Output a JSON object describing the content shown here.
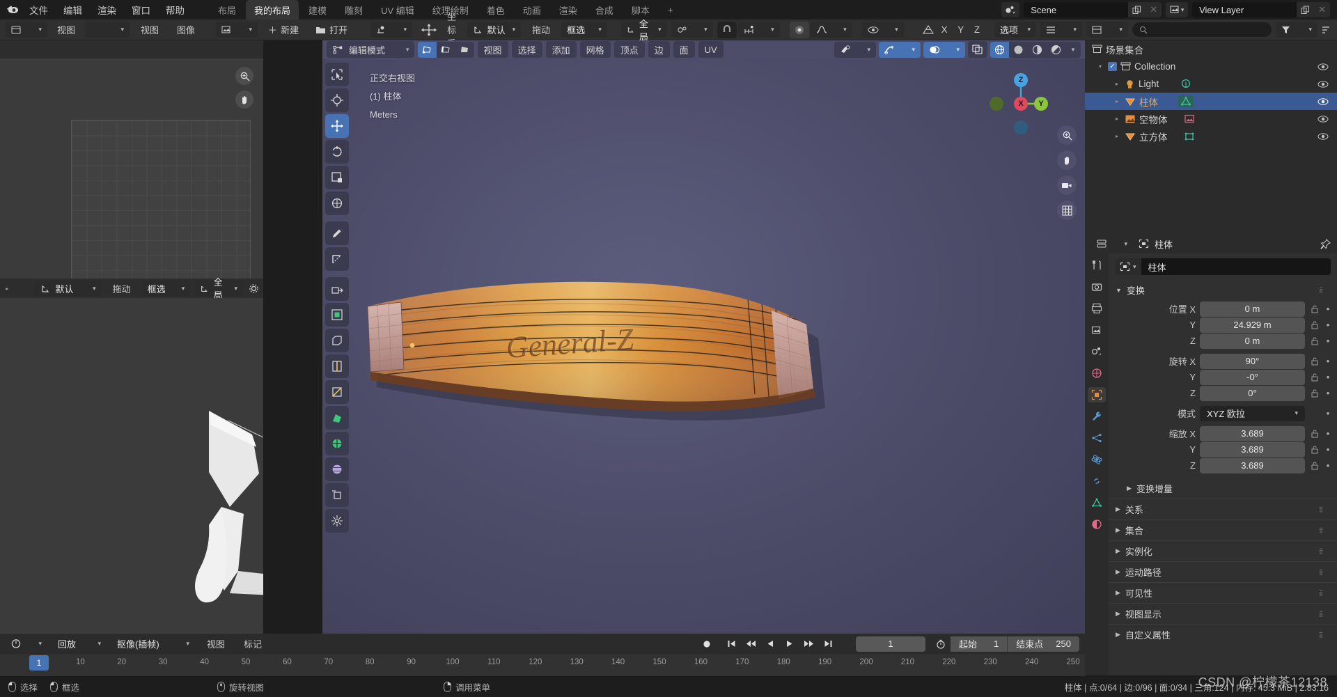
{
  "topbar": {
    "logo_icon": "blender-logo-icon",
    "menus": [
      "文件",
      "编辑",
      "渲染",
      "窗口",
      "帮助"
    ],
    "workspaces": [
      {
        "label": "布局",
        "selected": false
      },
      {
        "label": "我的布局",
        "selected": true
      },
      {
        "label": "建模",
        "selected": false
      },
      {
        "label": "雕刻",
        "selected": false
      },
      {
        "label": "UV 编辑",
        "selected": false
      },
      {
        "label": "纹理绘制",
        "selected": false
      },
      {
        "label": "着色",
        "selected": false
      },
      {
        "label": "动画",
        "selected": false
      },
      {
        "label": "渲染",
        "selected": false
      },
      {
        "label": "合成",
        "selected": false
      },
      {
        "label": "脚本",
        "selected": false
      },
      {
        "label": "+",
        "selected": false
      }
    ],
    "scene": {
      "icon": "scene-icon",
      "value": "Scene",
      "copy_icon": "duplicate-icon",
      "close_icon": "x-icon"
    },
    "viewlayer": {
      "icon": "view-layer-icon",
      "value": "View Layer",
      "copy_icon": "duplicate-icon",
      "close_icon": "x-icon"
    }
  },
  "toolrow": {
    "editor_icon": "editor-type-icon",
    "view_label": "视图",
    "view2_label": "视图",
    "image_label": "图像",
    "new_label": "新建",
    "open_label": "打开",
    "new_icon": "plus-icon",
    "open_icon": "folder-icon",
    "pivot_icon": "pivot-icon",
    "snap_move_icon": "transform-move-icon",
    "orientation_label": "坐标系:",
    "orientation_value": "默认",
    "drag_label": "拖动",
    "drag_value": "框选",
    "global_value": "全局",
    "proportional_icon": "proportional-edit-icon",
    "snap_icon": "magnet-icon",
    "snap_target_icon": "snap-target-icon",
    "falloff_icon": "falloff-icon",
    "visibility_icon": "eye-icon",
    "overlay_icon": "overlay-icon",
    "axis_x": "X",
    "axis_y": "Y",
    "axis_z": "Z",
    "options_label": "选项",
    "search_placeholder": "",
    "filter_icon": "funnel-icon",
    "sort_icon": "sort-icon",
    "search_icon": "search-icon"
  },
  "left_top_editor": {
    "editor_icon": "uv-editor-icon",
    "menus": [
      "视图",
      "视图",
      "图像"
    ],
    "new_label": "新建",
    "open_label": "打开",
    "zoom_icon": "zoom-icon",
    "hand_icon": "hand-icon"
  },
  "left_bottom_editor": {
    "orientation_value": "默认",
    "drag_label": "拖动",
    "drag_value": "框选",
    "global_value": "全局",
    "gear_icon": "gear-icon"
  },
  "viewport": {
    "mode": "编辑模式",
    "mode_icon": "edit-mode-icon",
    "select_modes": [
      {
        "name": "vertex-select",
        "active": true
      },
      {
        "name": "edge-select",
        "active": false
      },
      {
        "name": "face-select",
        "active": false
      }
    ],
    "menus": [
      "视图",
      "选择",
      "添加",
      "网格",
      "顶点",
      "边",
      "面",
      "UV"
    ],
    "overlay_toggles": [
      "visibility-icon",
      "snap-icon",
      "overlays-icon",
      "xray-icon"
    ],
    "shading_modes": [
      "wireframe-shading",
      "solid-shading",
      "material-shading",
      "rendered-shading"
    ],
    "shading_active_index": 0,
    "overlay_text": [
      "正交右视图",
      "(1) 柱体",
      "Meters"
    ],
    "gizmo_axes": [
      {
        "label": "Z",
        "color": "#4aa3e0"
      },
      {
        "label": "X",
        "color": "#e04a5f"
      },
      {
        "label": "Y",
        "color": "#8cc63f"
      }
    ],
    "right_buttons": [
      "zoom-icon",
      "hand-icon",
      "camera-icon",
      "grid-icon"
    ],
    "tools": [
      {
        "name": "tweak-tool",
        "active": false
      },
      {
        "name": "cursor-tool",
        "active": false
      },
      {
        "name": "move-tool",
        "active": true
      },
      {
        "name": "rotate-tool",
        "active": false
      },
      {
        "name": "scale-tool",
        "active": false
      },
      {
        "name": "transform-tool",
        "active": false
      },
      {
        "name": "annotate-tool",
        "active": false
      },
      {
        "name": "measure-tool",
        "active": false
      },
      {
        "name": "extrude-region-tool",
        "active": false
      },
      {
        "name": "inset-faces-tool",
        "active": false
      },
      {
        "name": "bevel-tool",
        "active": false
      },
      {
        "name": "loop-cut-tool",
        "active": false
      },
      {
        "name": "knife-tool",
        "active": false
      },
      {
        "name": "poly-build-tool",
        "active": false
      },
      {
        "name": "spin-tool",
        "active": false
      },
      {
        "name": "smooth-tool",
        "active": false
      },
      {
        "name": "shear-tool",
        "active": false
      },
      {
        "name": "rip-region-tool",
        "active": false
      }
    ],
    "artwork_text": "General-Z"
  },
  "outliner": {
    "editor_icon": "outliner-icon",
    "filter_icon": "filter-icon",
    "search_placeholder": "",
    "search_icon": "search-icon",
    "root_label": "场景集合",
    "root_icon": "collection-icon",
    "items": [
      {
        "label": "Collection",
        "icon": "collection-icon",
        "depth": 1,
        "selected": false,
        "checkbox": true,
        "expanded": true,
        "eye": true
      },
      {
        "label": "Light",
        "icon": "light-icon",
        "type_icon": "light-data-icon",
        "depth": 2,
        "selected": false,
        "eye": true
      },
      {
        "label": "柱体",
        "icon": "mesh-icon",
        "type_icon": "mesh-data-icon",
        "depth": 2,
        "selected": true,
        "eye": true
      },
      {
        "label": "空物体",
        "icon": "empty-image-icon",
        "type_icon": "empty-image-data-icon",
        "depth": 2,
        "selected": false,
        "eye": true
      },
      {
        "label": "立方体",
        "icon": "mesh-icon",
        "type_icon": "mesh-data-icon",
        "depth": 2,
        "selected": false,
        "eye": true
      }
    ]
  },
  "properties": {
    "editor_icon": "properties-icon",
    "breadcrumb_icon": "object-icon",
    "breadcrumb": "柱体",
    "pin_icon": "pin-icon",
    "object_name": "柱体",
    "object_name_icon": "object-icon",
    "tabs": [
      {
        "name": "tool-tab",
        "icon": "wrench-screwdriver-icon",
        "active": false,
        "color": "#c9c9c9"
      },
      {
        "name": "render-tab",
        "icon": "camera-back-icon",
        "active": false,
        "color": "#c9c9c9"
      },
      {
        "name": "output-tab",
        "icon": "printer-icon",
        "active": false,
        "color": "#c9c9c9"
      },
      {
        "name": "view-layer-tab",
        "icon": "images-icon",
        "active": false,
        "color": "#c9c9c9"
      },
      {
        "name": "scene-tab",
        "icon": "cone-sphere-icon",
        "active": false,
        "color": "#c9c9c9"
      },
      {
        "name": "world-tab",
        "icon": "world-icon",
        "active": false,
        "color": "#e06a8a"
      },
      {
        "name": "object-tab",
        "icon": "object-square-icon",
        "active": true,
        "color": "#e58d3d"
      },
      {
        "name": "modifier-tab",
        "icon": "wrench-icon",
        "active": false,
        "color": "#5b9bd5"
      },
      {
        "name": "particles-tab",
        "icon": "particles-icon",
        "active": false,
        "color": "#5b9bd5"
      },
      {
        "name": "physics-tab",
        "icon": "physics-icon",
        "active": false,
        "color": "#5b9bd5"
      },
      {
        "name": "constraints-tab",
        "icon": "constraint-icon",
        "active": false,
        "color": "#5b9bd5"
      },
      {
        "name": "data-tab",
        "icon": "mesh-data-icon",
        "active": false,
        "color": "#3ec1a0"
      },
      {
        "name": "material-tab",
        "icon": "material-sphere-icon",
        "active": false,
        "color": "#e06a8a"
      }
    ],
    "transform_section": {
      "title": "变换",
      "expanded": true,
      "location_label": "位置",
      "location": [
        {
          "axis": "X",
          "value": "0 m"
        },
        {
          "axis": "Y",
          "value": "24.929 m"
        },
        {
          "axis": "Z",
          "value": "0 m"
        }
      ],
      "rotation_label": "旋转",
      "rotation": [
        {
          "axis": "X",
          "value": "90°"
        },
        {
          "axis": "Y",
          "value": "-0°"
        },
        {
          "axis": "Z",
          "value": "0°"
        }
      ],
      "mode_label": "模式",
      "mode_value": "XYZ 欧拉",
      "scale_label": "缩放",
      "scale": [
        {
          "axis": "X",
          "value": "3.689"
        },
        {
          "axis": "Y",
          "value": "3.689"
        },
        {
          "axis": "Z",
          "value": "3.689"
        }
      ]
    },
    "subsection": {
      "label": "变换增量"
    },
    "collapsed_sections": [
      "关系",
      "集合",
      "实例化",
      "运动路径",
      "可见性",
      "视图显示",
      "自定义属性"
    ]
  },
  "timeline": {
    "editor_icon": "timeline-icon",
    "playback_label": "回放",
    "keying_label": "抠像(插帧)",
    "view_label": "视图",
    "marker_label": "标记",
    "transport": [
      "record-icon",
      "jump-start-icon",
      "prev-keyframe-icon",
      "play-reverse-icon",
      "play-icon",
      "next-keyframe-icon",
      "jump-end-icon"
    ],
    "current_frame": "1",
    "start_label": "起始",
    "start_value": "1",
    "end_label": "结束点",
    "end_value": "250",
    "clock_icon": "stopwatch-icon",
    "ticks": [
      10,
      20,
      30,
      40,
      50,
      60,
      70,
      80,
      90,
      100,
      110,
      120,
      130,
      140,
      150,
      160,
      170,
      180,
      190,
      200,
      210,
      220,
      230,
      240,
      250
    ],
    "playhead_label": "1"
  },
  "statusbar": {
    "hints": [
      {
        "icon": "mouse-left-icon",
        "label": "选择"
      },
      {
        "icon": "mouse-left-drag-icon",
        "label": "框选"
      },
      {
        "icon": "mouse-middle-icon",
        "label": "旋转视图"
      },
      {
        "icon": "mouse-right-icon",
        "label": "调用菜单"
      }
    ],
    "stats": "柱体 | 点:0/64 | 边:0/96 | 面:0/34 | 三角:124 | 内存: 45.3 MiB | 2.83.16",
    "watermark": "CSDN @柠檬茶12138"
  }
}
